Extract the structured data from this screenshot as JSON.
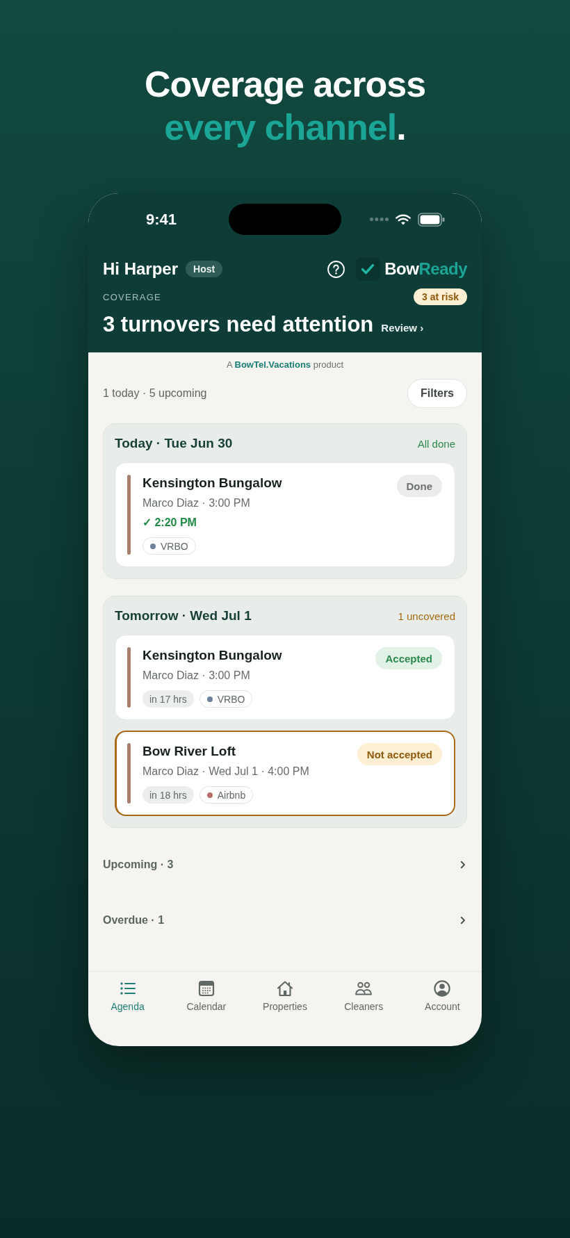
{
  "headline": {
    "lines": [
      [
        {
          "text": "Coverage across",
          "accent": false
        }
      ],
      [
        {
          "text": "every channel",
          "accent": true
        },
        {
          "text": ".",
          "accent": false
        }
      ]
    ]
  },
  "status_bar": {
    "time": "9:41"
  },
  "header": {
    "greeting": "Hi Harper",
    "role_badge": "Host",
    "brand_name": [
      {
        "text": "Bow",
        "accent": false
      },
      {
        "text": "Ready",
        "accent": true
      }
    ],
    "section_label": "COVERAGE",
    "risk_badge": "3 at risk",
    "title": "3 turnovers need attention",
    "review_link": "Review ›"
  },
  "attribution": {
    "before": "A ",
    "link": "BowTel.Vacations",
    "after": " product"
  },
  "summary": {
    "text": "1 today · 5 upcoming",
    "filters_button": "Filters"
  },
  "days": [
    {
      "title": "Today · Tue Jun 30",
      "status": {
        "text": "All done",
        "kind": "ok"
      },
      "turnovers": [
        {
          "property": "Kensington Bungalow",
          "details": "Marco Diaz · 3:00 PM",
          "completed_at": "✓ 2:20 PM",
          "at_risk": false,
          "badge": {
            "label": "Done",
            "kind": "done"
          },
          "tags": [
            {
              "kind": "channel",
              "label": "VRBO",
              "color": "#6f829b"
            }
          ]
        }
      ]
    },
    {
      "title": "Tomorrow · Wed Jul 1",
      "status": {
        "text": "1 uncovered",
        "kind": "warning"
      },
      "turnovers": [
        {
          "property": "Kensington Bungalow",
          "details": "Marco Diaz · 3:00 PM",
          "at_risk": false,
          "badge": {
            "label": "Accepted",
            "kind": "accepted"
          },
          "tags": [
            {
              "kind": "eta",
              "label": "in 17 hrs"
            },
            {
              "kind": "channel",
              "label": "VRBO",
              "color": "#6f829b"
            }
          ]
        },
        {
          "property": "Bow River Loft",
          "details": "Marco Diaz · Wed Jul 1 · 4:00 PM",
          "at_risk": true,
          "badge": {
            "label": "Not accepted",
            "kind": "not_accepted"
          },
          "tags": [
            {
              "kind": "eta",
              "label": "in 18 hrs"
            },
            {
              "kind": "channel",
              "label": "Airbnb",
              "color": "#b8706a"
            }
          ]
        }
      ]
    }
  ],
  "groups": [
    {
      "label": "Upcoming · 3"
    },
    {
      "label": "Overdue · 1"
    }
  ],
  "tab_bar": [
    {
      "label": "Agenda",
      "selected": true
    },
    {
      "label": "Calendar",
      "selected": false
    },
    {
      "label": "Properties",
      "selected": false
    },
    {
      "label": "Cleaners",
      "selected": false
    },
    {
      "label": "Account",
      "selected": false
    }
  ]
}
